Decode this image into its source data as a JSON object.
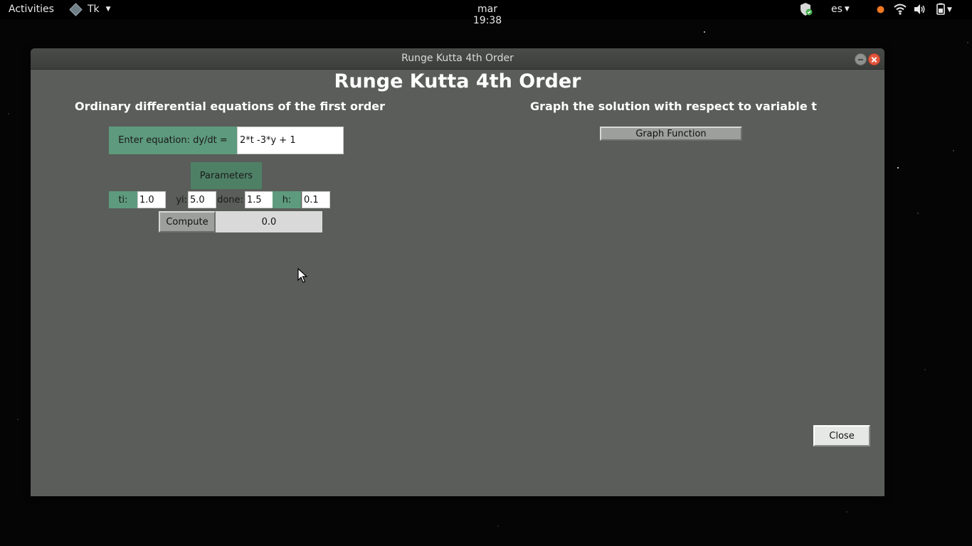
{
  "topbar": {
    "activities": "Activities",
    "app_name": "Tk",
    "clock": "mar 19:38",
    "keyboard_layout": "es",
    "icons": [
      "shield-icon",
      "notification-dot-icon",
      "wifi-icon",
      "volume-icon",
      "battery-icon"
    ]
  },
  "window": {
    "title": "Runge Kutta 4th Order",
    "heading": "Runge Kutta 4th Order",
    "left_subheading": "Ordinary differential equations of the first order",
    "right_subheading": "Graph the solution with respect to variable t",
    "equation_label": "Enter equation: dy/dt =",
    "equation_value": "2*t -3*y + 1",
    "parameters_label": "Parameters",
    "params": {
      "ti_label": "ti:",
      "ti_value": "1.0",
      "yi_label": "yi:",
      "yi_value": "5.0",
      "done_label": "done:",
      "done_value": "1.5",
      "h_label": "h:",
      "h_value": "0.1"
    },
    "compute_label": "Compute",
    "result_value": "0.0",
    "graph_label": "Graph Function",
    "close_label": "Close"
  },
  "colors": {
    "window_bg": "#5a5d5a",
    "label_green": "#5e9a7d",
    "parameters_green": "#4e8066"
  }
}
